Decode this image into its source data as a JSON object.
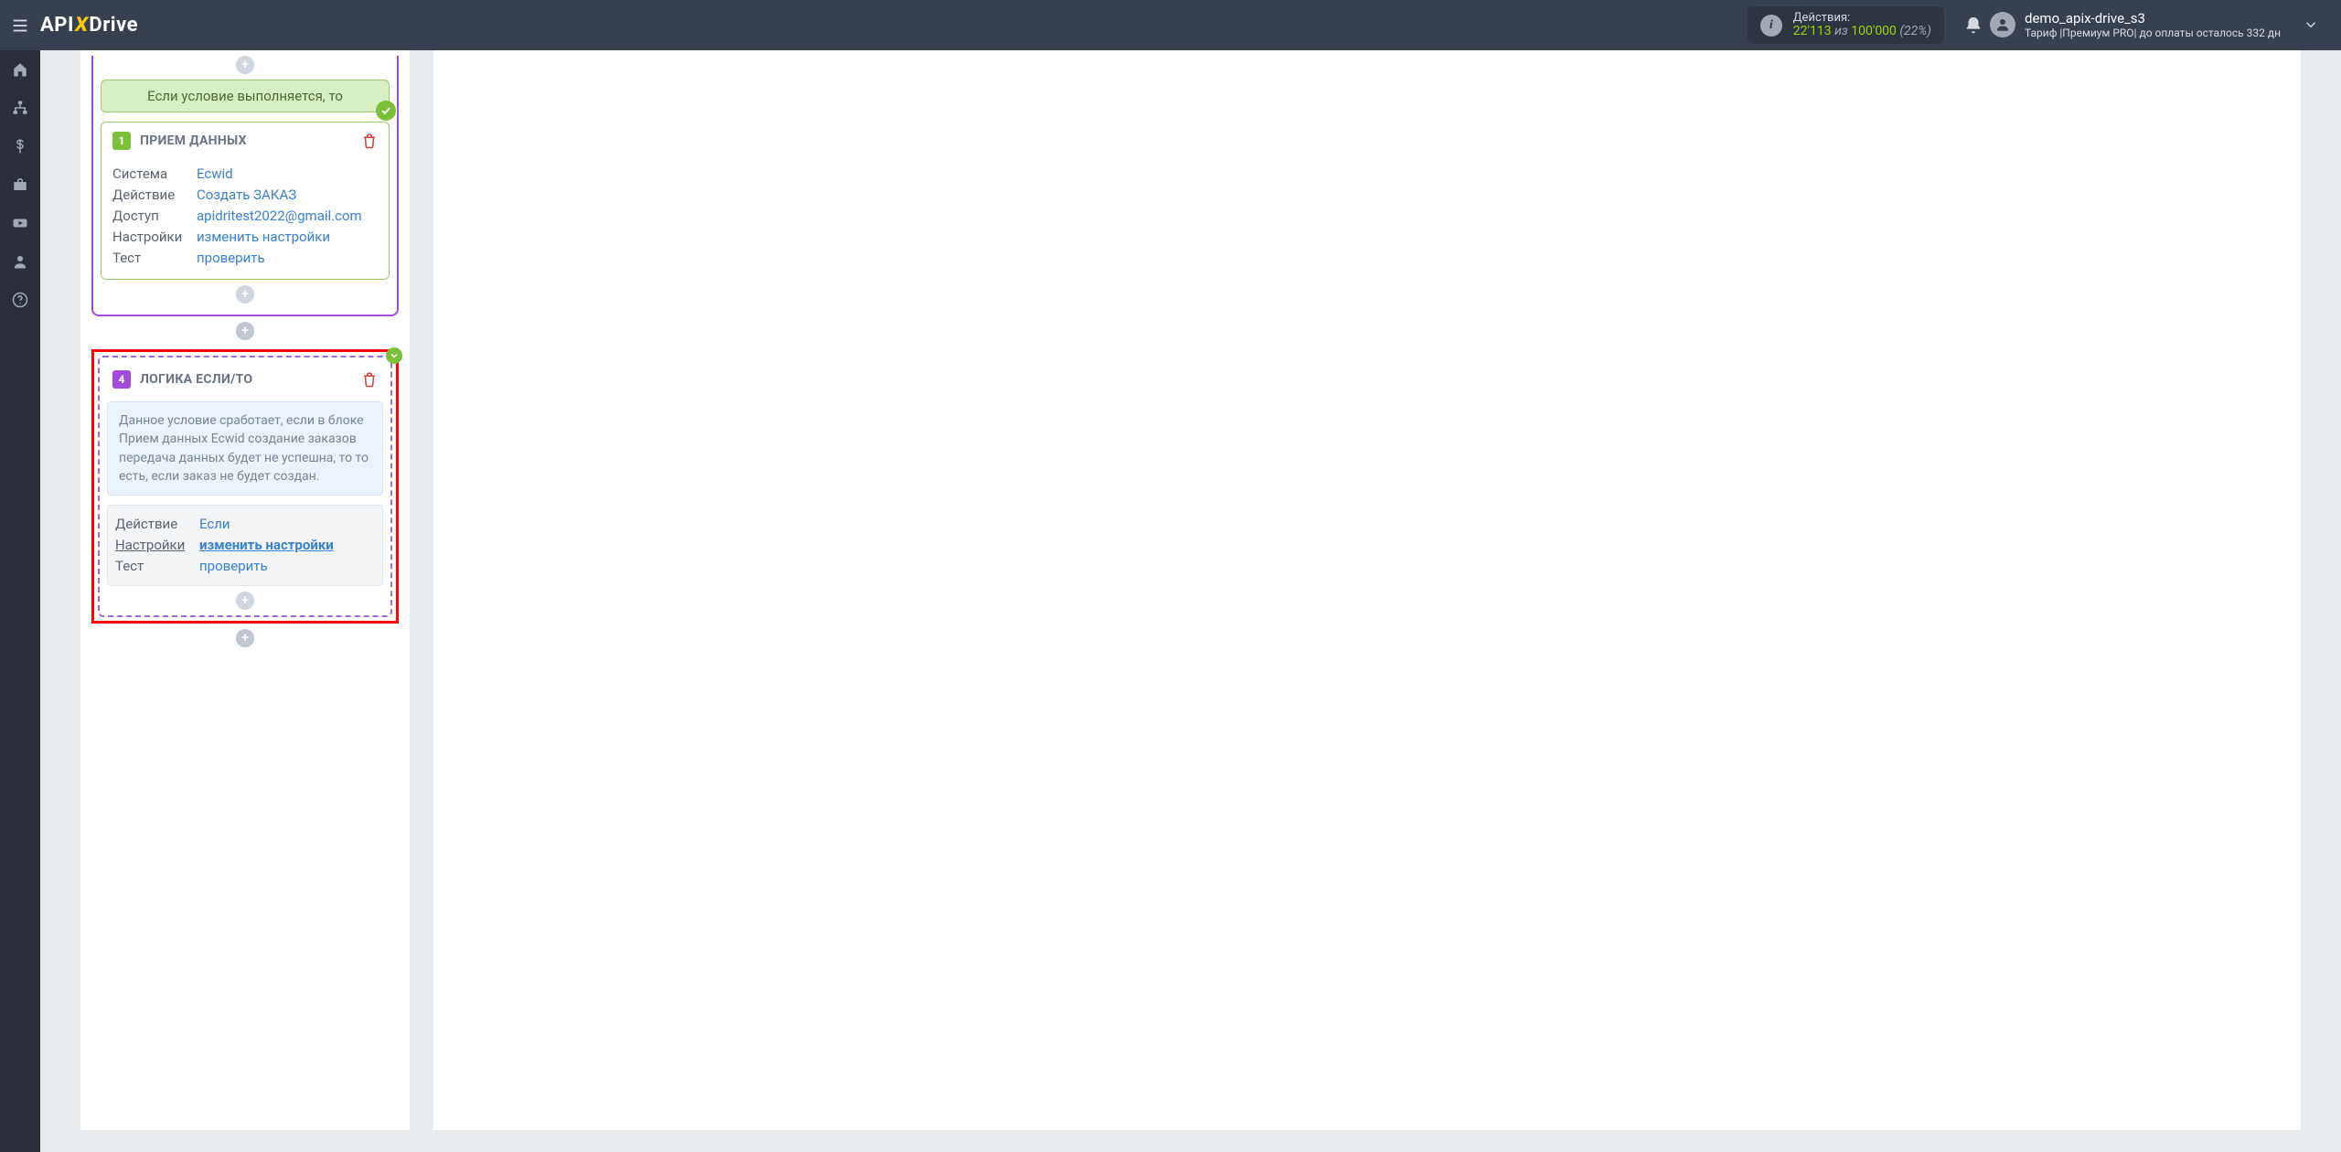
{
  "header": {
    "actions_label": "Действия:",
    "actions_used": "22'113",
    "actions_of": "из",
    "actions_total": "100'000",
    "actions_pct": "(22%)",
    "user_name": "demo_apix-drive_s3",
    "user_tariff": "Тариф |Премиум PRO| до оплаты осталось 332 дн"
  },
  "logo": {
    "api": "API",
    "x": "X",
    "drive": "Drive"
  },
  "block1": {
    "banner": "Если условие выполняется, то",
    "num": "1",
    "title": "ПРИЕМ ДАННЫХ",
    "system_k": "Система",
    "system_v": "Ecwid",
    "action_k": "Действие",
    "action_v": "Создать ЗАКАЗ",
    "access_k": "Доступ",
    "access_v": "apidritest2022@gmail.com",
    "settings_k": "Настройки",
    "settings_v": "изменить настройки",
    "test_k": "Тест",
    "test_v": "проверить"
  },
  "block4": {
    "num": "4",
    "title": "ЛОГИКА ЕСЛИ/ТО",
    "info": "Данное условие сработает, если в блоке Прием данных Ecwid создание заказов передача данных будет не успешна, то то есть, если заказ не будет создан.",
    "action_k": "Действие",
    "action_v": "Если",
    "settings_k": "Настройки",
    "settings_v": "изменить настройки",
    "test_k": "Тест",
    "test_v": "проверить"
  }
}
